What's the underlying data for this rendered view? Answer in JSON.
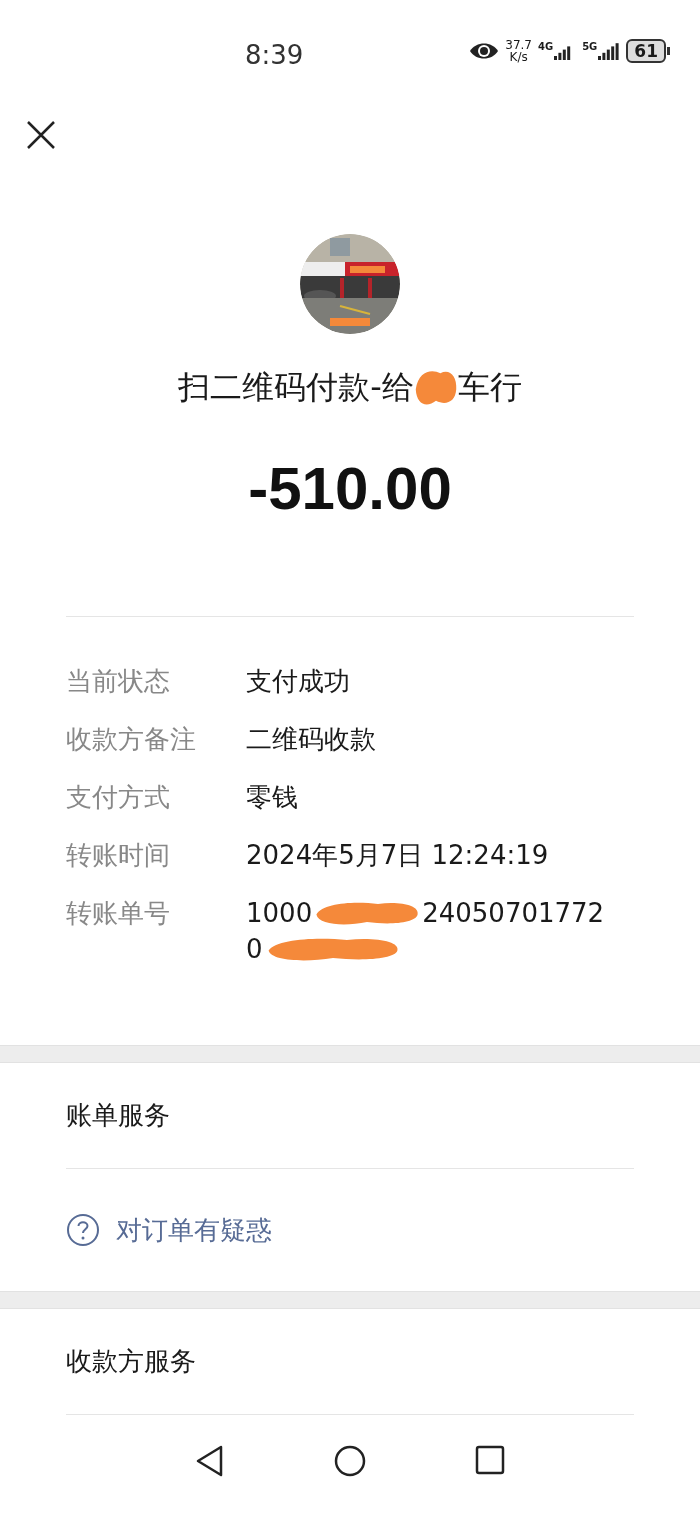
{
  "status_bar": {
    "time": "8:39",
    "speed": "37.7",
    "speed_unit": "K/s",
    "network_1": "4G",
    "network_2": "5G",
    "battery": "61"
  },
  "payment": {
    "title_start": "扫二维码付款-给",
    "title_end": "车行",
    "amount": "-510.00"
  },
  "details": [
    {
      "label": "当前状态",
      "value": "支付成功"
    },
    {
      "label": "收款方备注",
      "value": "二维码收款"
    },
    {
      "label": "支付方式",
      "value": "零钱"
    },
    {
      "label": "转账时间",
      "value": "2024年5月7日 12:24:19"
    }
  ],
  "order_number": {
    "label": "转账单号",
    "lines": [
      {
        "before": "1000",
        "after": "24050701772"
      },
      {
        "before": "0"
      }
    ]
  },
  "bill_service": {
    "title": "账单服务",
    "link": "对订单有疑惑"
  },
  "payee_service": {
    "title": "收款方服务"
  }
}
